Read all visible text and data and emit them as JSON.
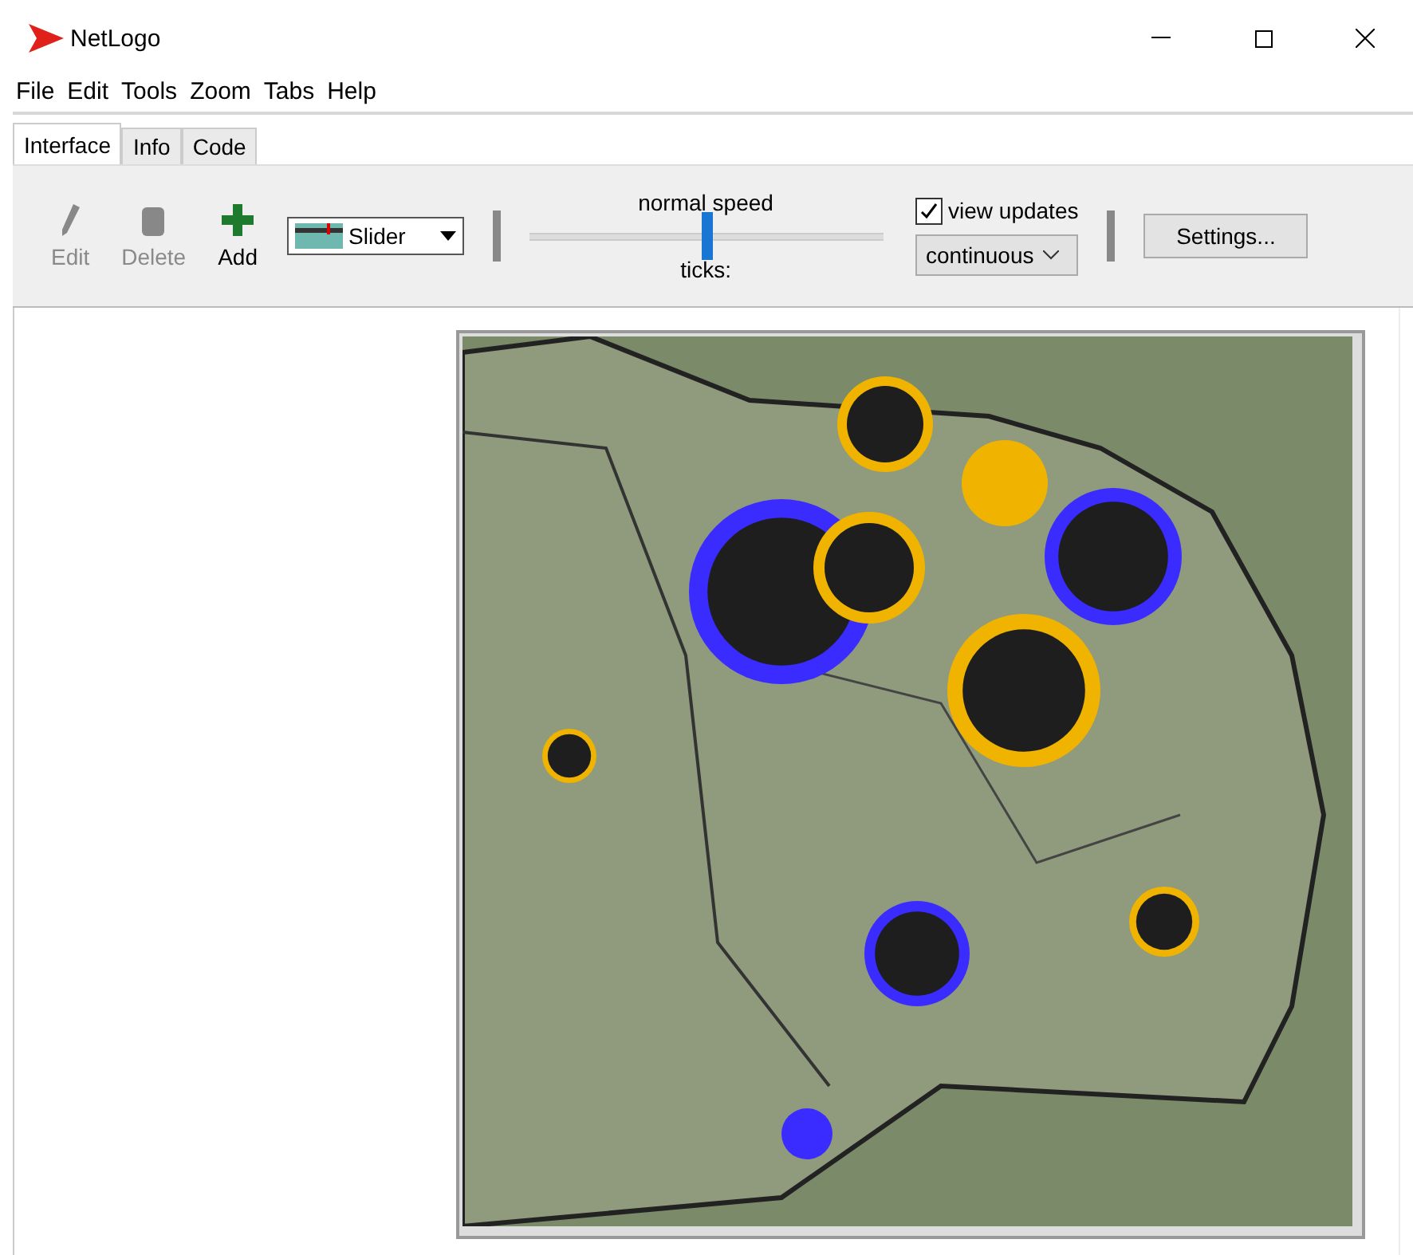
{
  "window": {
    "title": "NetLogo"
  },
  "menu": [
    "File",
    "Edit",
    "Tools",
    "Zoom",
    "Tabs",
    "Help"
  ],
  "tabs": [
    {
      "label": "Interface",
      "selected": true
    },
    {
      "label": "Info",
      "selected": false
    },
    {
      "label": "Code",
      "selected": false
    }
  ],
  "toolbar": {
    "tools": [
      {
        "label": "Edit",
        "kind": "edit",
        "disabled": true
      },
      {
        "label": "Delete",
        "kind": "delete",
        "disabled": true
      },
      {
        "label": "Add",
        "kind": "add",
        "disabled": false
      }
    ],
    "widget_select": {
      "value": "Slider"
    },
    "speed": {
      "label": "normal speed",
      "level": 0.5,
      "ticks_label": "ticks:"
    },
    "view_updates": {
      "label": "view updates",
      "checked": true,
      "mode": "continuous"
    },
    "settings_button": "Settings..."
  }
}
